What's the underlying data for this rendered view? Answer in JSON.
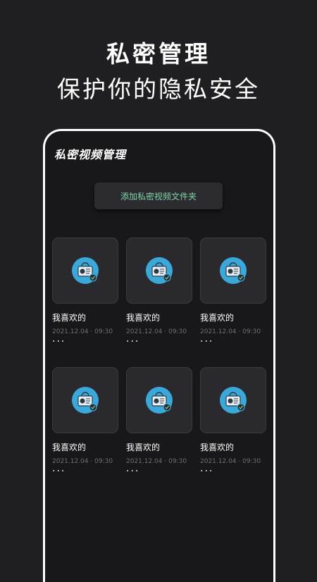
{
  "promo": {
    "headline": "私密管理",
    "subline": "保护你的隐私安全"
  },
  "screen": {
    "title": "私密视频管理",
    "add_folder_label": "添加私密视频文件夹",
    "folders": [
      {
        "name": "我喜欢的",
        "date": "2021.12.04 · 09:30",
        "more": "···",
        "icon": "video-lock-icon"
      },
      {
        "name": "我喜欢的",
        "date": "2021.12.04 · 09:30",
        "more": "···",
        "icon": "video-lock-icon"
      },
      {
        "name": "我喜欢的",
        "date": "2021.12.04 · 09:30",
        "more": "···",
        "icon": "video-lock-icon"
      },
      {
        "name": "我喜欢的",
        "date": "2021.12.04 · 09:30",
        "more": "···",
        "icon": "video-lock-icon"
      },
      {
        "name": "我喜欢的",
        "date": "2021.12.04 · 09:30",
        "more": "···",
        "icon": "video-lock-icon"
      },
      {
        "name": "我喜欢的",
        "date": "2021.12.04 · 09:30",
        "more": "···",
        "icon": "video-lock-icon"
      }
    ]
  },
  "colors": {
    "background": "#1f1f21",
    "screen": "#18181a",
    "accent_text": "#7fd6a8",
    "icon_blue": "#3aa8d8"
  }
}
